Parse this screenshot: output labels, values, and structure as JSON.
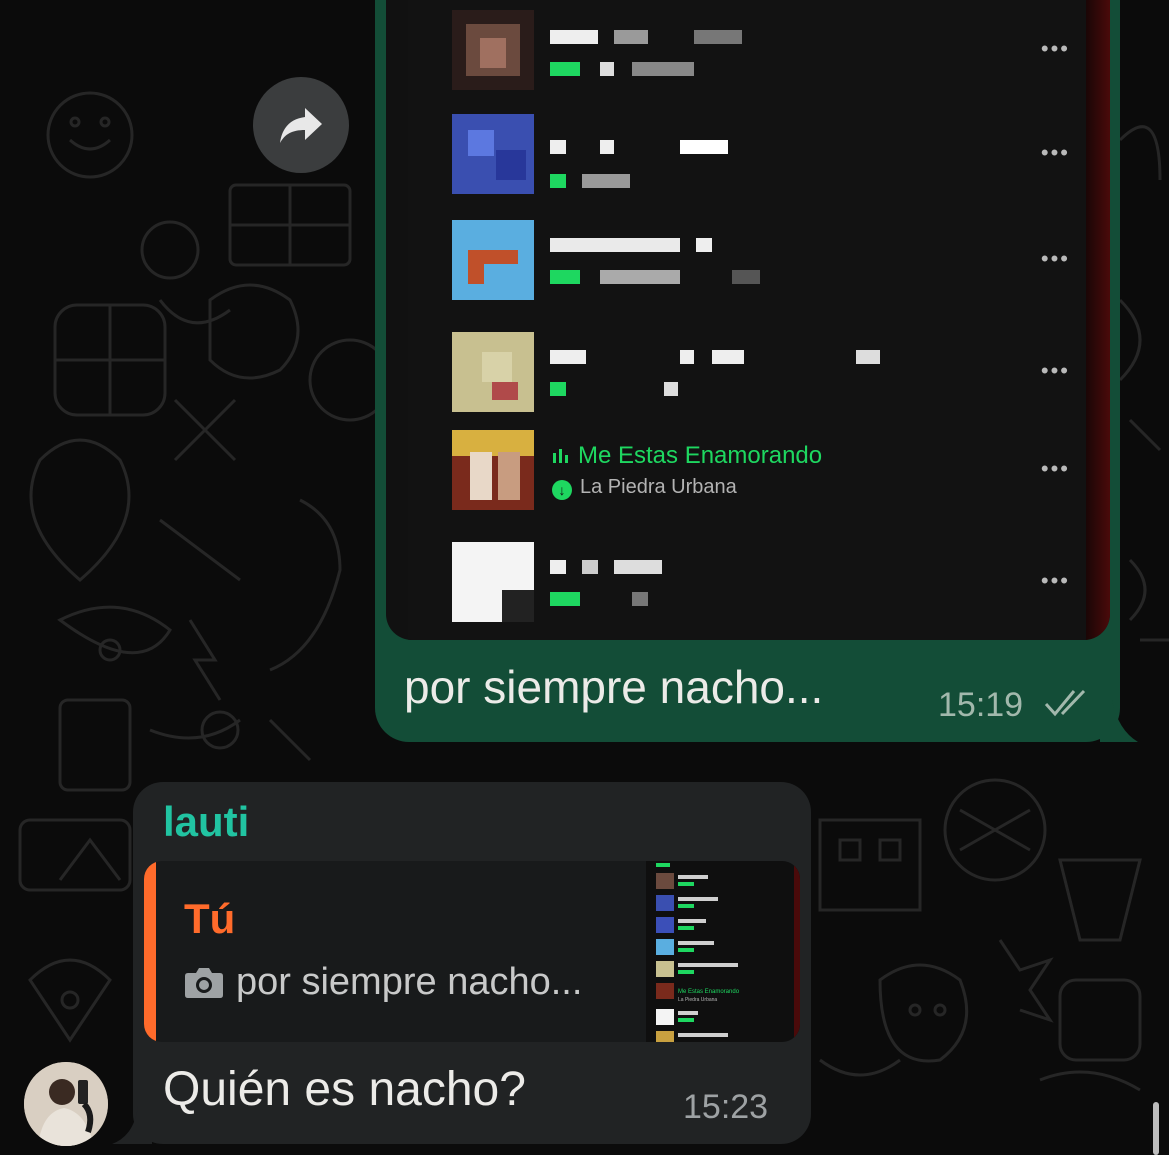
{
  "colors": {
    "background": "#0b0b0b",
    "outgoing_bubble": "#134d37",
    "incoming_bubble": "#212324",
    "sender_name": "#21c4a2",
    "quote_accent": "#ff6b2b",
    "spotify_green": "#1ed760"
  },
  "forward_button": {
    "icon": "forward-arrow-icon"
  },
  "outgoing": {
    "media": {
      "type": "spotify-playlist-screenshot",
      "highlighted_track": {
        "title": "Me Estas Enamorando",
        "artist": "La Piedra Urbana"
      },
      "track_menu_glyph": "•••"
    },
    "caption": "por siempre nacho...",
    "time": "15:19",
    "status_icon": "double-check-icon"
  },
  "incoming": {
    "sender": "lauti",
    "quote": {
      "author": "Tú",
      "icon": "camera-icon",
      "text": "por siempre nacho...",
      "thumb_title": "Me Estas Enamorando",
      "thumb_artist": "La Piedra Urbana"
    },
    "message": "Quién es nacho?",
    "time": "15:23",
    "avatar": "user-avatar"
  }
}
